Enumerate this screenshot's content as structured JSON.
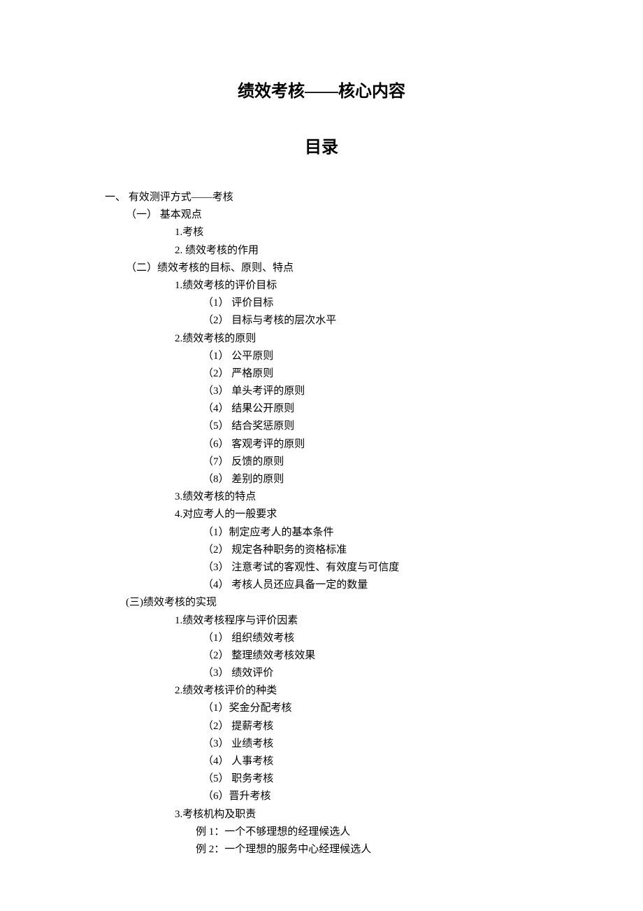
{
  "title": "绩效考核——核心内容",
  "subtitle": "目录",
  "o": {
    "i1": "一、 有效测评方式——考核",
    "i1_1": "（一） 基本观点",
    "i1_1_1": "1.考核",
    "i1_1_2": "2. 绩效考核的作用",
    "i1_2": "（二）绩效考核的目标、原则、特点",
    "i1_2_1": "1.绩效考核的评价目标",
    "i1_2_1_1": "（1） 评价目标",
    "i1_2_1_2": "（2） 目标与考核的层次水平",
    "i1_2_2": "2.绩效考核的原则",
    "i1_2_2_1": "（1） 公平原则",
    "i1_2_2_2": "（2） 严格原则",
    "i1_2_2_3": "（3） 单头考评的原则",
    "i1_2_2_4": "（4） 结果公开原则",
    "i1_2_2_5": "（5） 结合奖惩原则",
    "i1_2_2_6": "（6） 客观考评的原则",
    "i1_2_2_7": "（7） 反馈的原则",
    "i1_2_2_8": "（8） 差别的原则",
    "i1_2_3": "3.绩效考核的特点",
    "i1_2_4": "4.对应考人的一般要求",
    "i1_2_4_1": "（1）制定应考人的基本条件",
    "i1_2_4_2": "（2） 规定各种职务的资格标准",
    "i1_2_4_3": "（3） 注意考试的客观性、有效度与可信度",
    "i1_2_4_4": "（4） 考核人员还应具备一定的数量",
    "i1_3": "(三)绩效考核的实现",
    "i1_3_1": "1.绩效考核程序与评价因素",
    "i1_3_1_1": "（1） 组织绩效考核",
    "i1_3_1_2": "（2） 整理绩效考核效果",
    "i1_3_1_3": "（3） 绩效评价",
    "i1_3_2": "2.绩效考核评价的种类",
    "i1_3_2_1": "（1）奖金分配考核",
    "i1_3_2_2": "（2） 提薪考核",
    "i1_3_2_3": "（3） 业绩考核",
    "i1_3_2_4": "（4） 人事考核",
    "i1_3_2_5": "（5） 职务考核",
    "i1_3_2_6": "（6）晋升考核",
    "i1_3_3": "3.考核机构及职责",
    "i1_3_3_e1": "例 1：一个不够理想的经理候选人",
    "i1_3_3_e2": "例 2：一个理想的服务中心经理候选人"
  }
}
